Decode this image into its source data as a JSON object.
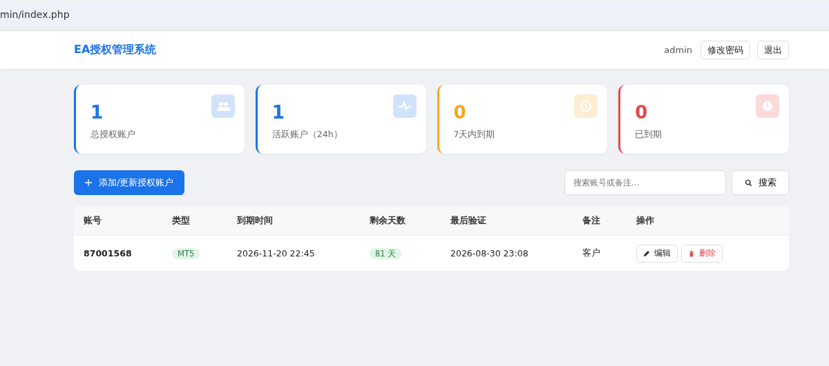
{
  "address_bar": {
    "url": "min/index.php"
  },
  "header": {
    "title": "EA授权管理系统",
    "user": "admin",
    "buttons": [
      "修改密码",
      "退出"
    ]
  },
  "stats": [
    {
      "value": "1",
      "label": "总授权账户",
      "color": "#1a73e8",
      "kind": "users"
    },
    {
      "value": "1",
      "label": "活跃账户（24h）",
      "color": "#1a73e8",
      "kind": "active"
    },
    {
      "value": "0",
      "label": "7天内到期",
      "color": "#f5a623",
      "kind": "clock"
    },
    {
      "value": "0",
      "label": "已到期",
      "color": "#e5484d",
      "kind": "alert"
    }
  ],
  "toolbar": {
    "add_button": "添加/更新授权账户",
    "search": {
      "placeholder": "搜索账号或备注..."
    },
    "search_button": "搜索"
  },
  "table": {
    "columns": [
      "账号",
      "类型",
      "到期时间",
      "剩余天数",
      "最后验证",
      "备注",
      "操作"
    ],
    "rows": [
      {
        "account": "87001568",
        "type": "MT5",
        "expires": "2026-11-20 22:45",
        "days": "81 天",
        "last_verified": "2026-08-30 23:08",
        "note": "客户",
        "edit": "编辑",
        "delete": "删除"
      }
    ]
  }
}
